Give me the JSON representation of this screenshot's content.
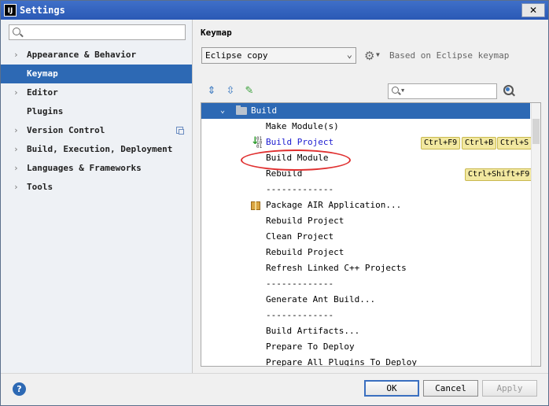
{
  "window": {
    "app_icon": "IJ",
    "title": "Settings",
    "close_label": "✕"
  },
  "sidebar": {
    "search_placeholder": "",
    "items": [
      {
        "label": "Appearance & Behavior",
        "arrow": "›"
      },
      {
        "label": "Keymap",
        "arrow": "",
        "selected": true
      },
      {
        "label": "Editor",
        "arrow": "›"
      },
      {
        "label": "Plugins",
        "arrow": ""
      },
      {
        "label": "Version Control",
        "arrow": "›"
      },
      {
        "label": "Build, Execution, Deployment",
        "arrow": "›"
      },
      {
        "label": "Languages & Frameworks",
        "arrow": "›"
      },
      {
        "label": "Tools",
        "arrow": "›"
      }
    ]
  },
  "main": {
    "title": "Keymap",
    "keymap_value": "Eclipse copy",
    "based_on": "Based on Eclipse keymap",
    "filter_placeholder": ""
  },
  "tree": {
    "group": "Build",
    "rows": [
      {
        "label": "Make Module(s)",
        "shortcuts": []
      },
      {
        "label": "Build Project",
        "shortcuts": [
          "Ctrl+F9",
          "Ctrl+B",
          "Ctrl+S"
        ]
      },
      {
        "label": "Build Module",
        "shortcuts": []
      },
      {
        "label": "Rebuild",
        "shortcuts": [
          "Ctrl+Shift+F9"
        ]
      },
      {
        "label": "-------------",
        "shortcuts": []
      },
      {
        "label": "Package AIR Application...",
        "shortcuts": []
      },
      {
        "label": "Rebuild Project",
        "shortcuts": []
      },
      {
        "label": "Clean Project",
        "shortcuts": []
      },
      {
        "label": "Rebuild Project",
        "shortcuts": []
      },
      {
        "label": "Refresh Linked C++ Projects",
        "shortcuts": []
      },
      {
        "label": "-------------",
        "shortcuts": []
      },
      {
        "label": "Generate Ant Build...",
        "shortcuts": []
      },
      {
        "label": "-------------",
        "shortcuts": []
      },
      {
        "label": "Build Artifacts...",
        "shortcuts": []
      },
      {
        "label": "Prepare To Deploy",
        "shortcuts": []
      },
      {
        "label": "Prepare All Plugins To Deploy",
        "shortcuts": []
      }
    ]
  },
  "footer": {
    "help_label": "?",
    "ok_label": "OK",
    "cancel_label": "Cancel",
    "apply_label": "Apply"
  },
  "colors": {
    "selection": "#2d69b4",
    "shortcut_bg": "#f2e8a0",
    "link": "#1a1ad0",
    "highlight_ellipse": "#e03030"
  }
}
